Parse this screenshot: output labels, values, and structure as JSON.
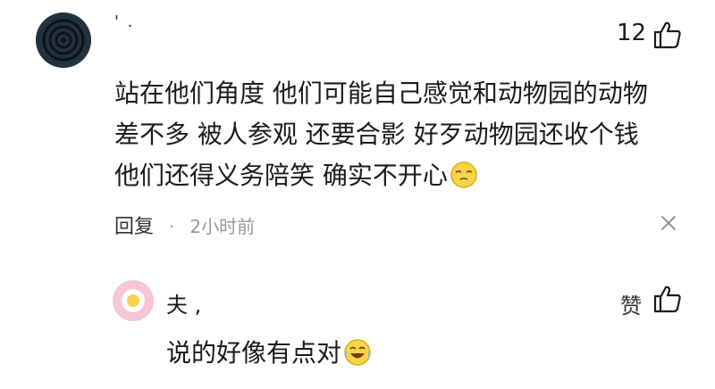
{
  "comment": {
    "username": "' .",
    "like_count": "12",
    "lines": [
      "站在他们角度 他们可能自己感觉和动物园的动物",
      "差不多 被人参观 还要合影 好歹动物园还收个钱",
      "他们还得义务陪笑 确实不开心"
    ],
    "reply_label": "回复",
    "separator": "·",
    "time": "2小时前"
  },
  "reply": {
    "username": "夫 ,",
    "zan_label": "赞",
    "text": "说的好像有点对"
  },
  "icons": {
    "avatar_main": "spiral-avatar",
    "like": "thumbs-up-icon",
    "close": "close-icon",
    "emoji1": "smirk-emoji",
    "emoji2": "laughing-tears-emoji",
    "avatar_reply": "flower-avatar"
  },
  "colors": {
    "text": "#1b1b1b",
    "meta": "#999999",
    "avatar_main_bg": "#24313f",
    "avatar_reply_bg": "#f6c5d6"
  }
}
